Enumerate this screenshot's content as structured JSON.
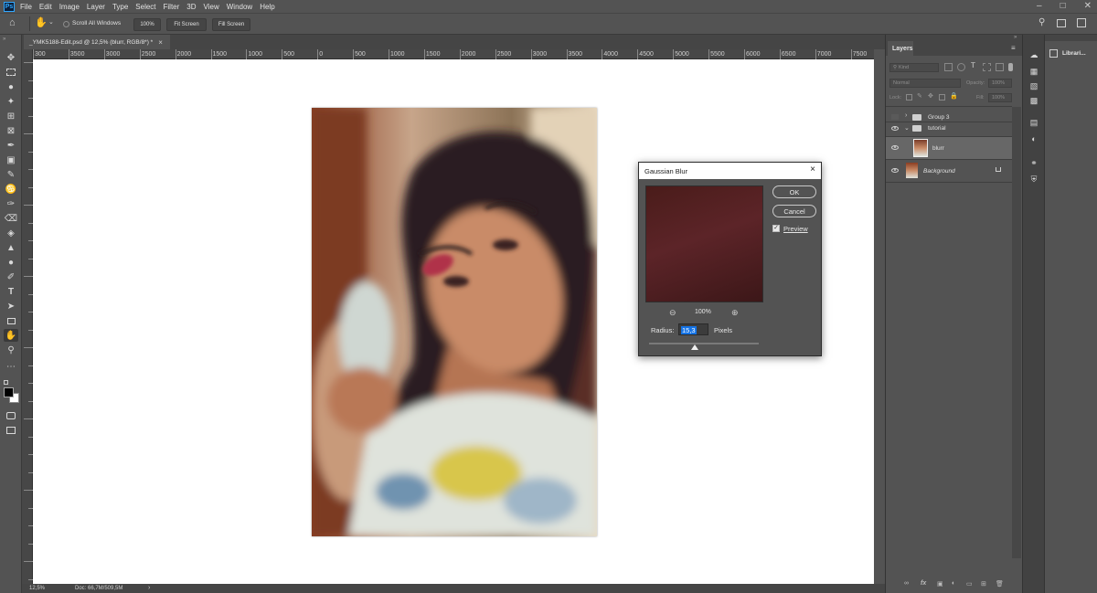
{
  "menubar": {
    "items": [
      "File",
      "Edit",
      "Image",
      "Layer",
      "Type",
      "Select",
      "Filter",
      "3D",
      "View",
      "Window",
      "Help"
    ]
  },
  "optionsbar": {
    "scroll_all_windows": "Scroll All Windows",
    "zoom_100": "100%",
    "fit_screen": "Fit Screen",
    "fill_screen": "Fill Screen"
  },
  "document": {
    "tab_title": "_YMK5188-Edit.psd @ 12,5% (blurr, RGB/8*) *",
    "ruler_labels": [
      "300",
      "3500",
      "3000",
      "2500",
      "2000",
      "1500",
      "1000",
      "500",
      "0",
      "500",
      "1000",
      "1500",
      "2000",
      "2500",
      "3000",
      "3500",
      "4000",
      "4500",
      "5000",
      "5500",
      "6000",
      "6500",
      "7000",
      "7500"
    ]
  },
  "statusbar": {
    "zoom": "12,5%",
    "doc_info": "Doc: 66,7M/509,5M"
  },
  "gaussian_dialog": {
    "title": "Gaussian Blur",
    "ok_label": "OK",
    "cancel_label": "Cancel",
    "preview_label": "Preview",
    "preview_checked": true,
    "zoom_level": "100%",
    "radius_label": "Radius:",
    "radius_value": "15,3",
    "units_label": "Pixels",
    "slider_fraction": 0.42
  },
  "layers_panel": {
    "tab_label": "Layers",
    "filter_placeholder": "Kind",
    "blend_mode": "Normal",
    "opacity_label": "Opacity:",
    "opacity_value": "100%",
    "lock_label": "Lock:",
    "fill_label": "Fill:",
    "fill_value": "100%",
    "layers": [
      {
        "name": "Group 3",
        "type": "group",
        "visible": false,
        "expanded": false
      },
      {
        "name": "tutorial",
        "type": "group",
        "visible": true,
        "expanded": true
      },
      {
        "name": "blurr",
        "type": "layer",
        "visible": true,
        "selected": true
      },
      {
        "name": "Background",
        "type": "layer",
        "visible": true,
        "locked": true
      }
    ]
  },
  "libraries_panel": {
    "label": "Librari..."
  },
  "colors": {
    "accent": "#31a8ff",
    "selection": "#1473e6"
  }
}
